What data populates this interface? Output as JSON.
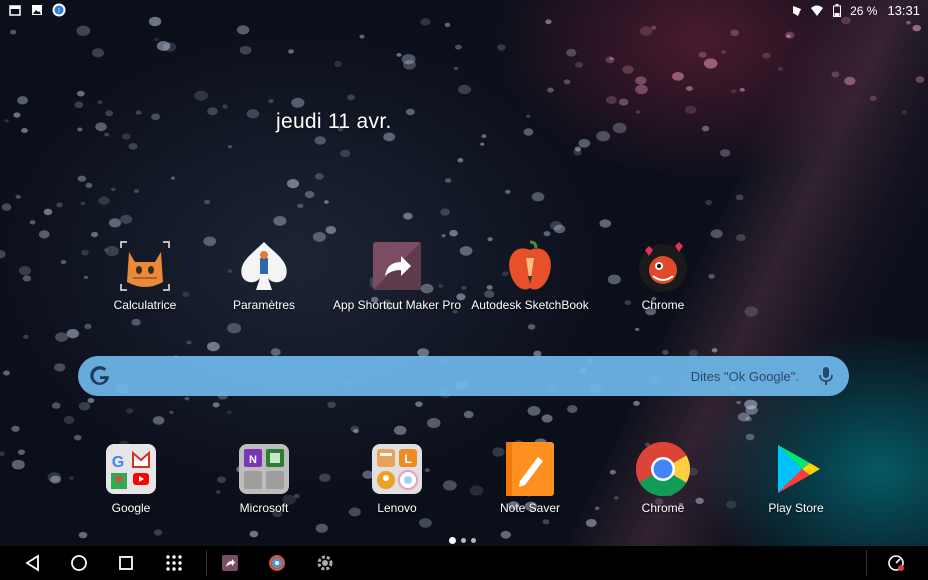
{
  "status_bar": {
    "battery_text": "26 %",
    "time": "13:31",
    "left_icons": [
      "calendar-icon",
      "image-icon",
      "notification-icon"
    ],
    "right_icons": [
      "phone-icon",
      "wifi-icon",
      "battery-icon"
    ]
  },
  "date": "jeudi 11 avr.",
  "apps_row1": [
    {
      "label": "Calculatrice",
      "icon": "cat-calculator-icon"
    },
    {
      "label": "Paramètres",
      "icon": "spade-settings-icon"
    },
    {
      "label": "App Shortcut Maker Pro",
      "icon": "shortcut-maker-icon"
    },
    {
      "label": "Autodesk SketchBook",
      "icon": "sketchbook-icon"
    },
    {
      "label": "Chrome",
      "icon": "monster-chrome-icon"
    }
  ],
  "search": {
    "hint": "Dites \"Ok Google\".",
    "icons": [
      "google-g-icon",
      "mic-icon"
    ]
  },
  "dock": [
    {
      "label": "Google",
      "icon": "google-folder-icon"
    },
    {
      "label": "Microsoft",
      "icon": "microsoft-folder-icon"
    },
    {
      "label": "Lenovo",
      "icon": "lenovo-folder-icon"
    },
    {
      "label": "Note Saver",
      "icon": "note-saver-icon"
    },
    {
      "label": "Chrome",
      "icon": "chrome-icon"
    },
    {
      "label": "Play Store",
      "icon": "play-store-icon"
    }
  ],
  "pager": {
    "pages": 3,
    "current": 1
  },
  "nav_bar": {
    "buttons": [
      "back-icon",
      "home-icon",
      "recents-icon",
      "app-drawer-icon"
    ],
    "pinned": [
      "shortcut-maker-icon",
      "gear-pinwheel-icon",
      "settings-gear-icon"
    ],
    "right": [
      "screen-recorder-icon"
    ]
  },
  "colors": {
    "search_bar": "#6eb9eb",
    "nav_bar": "#000000"
  }
}
